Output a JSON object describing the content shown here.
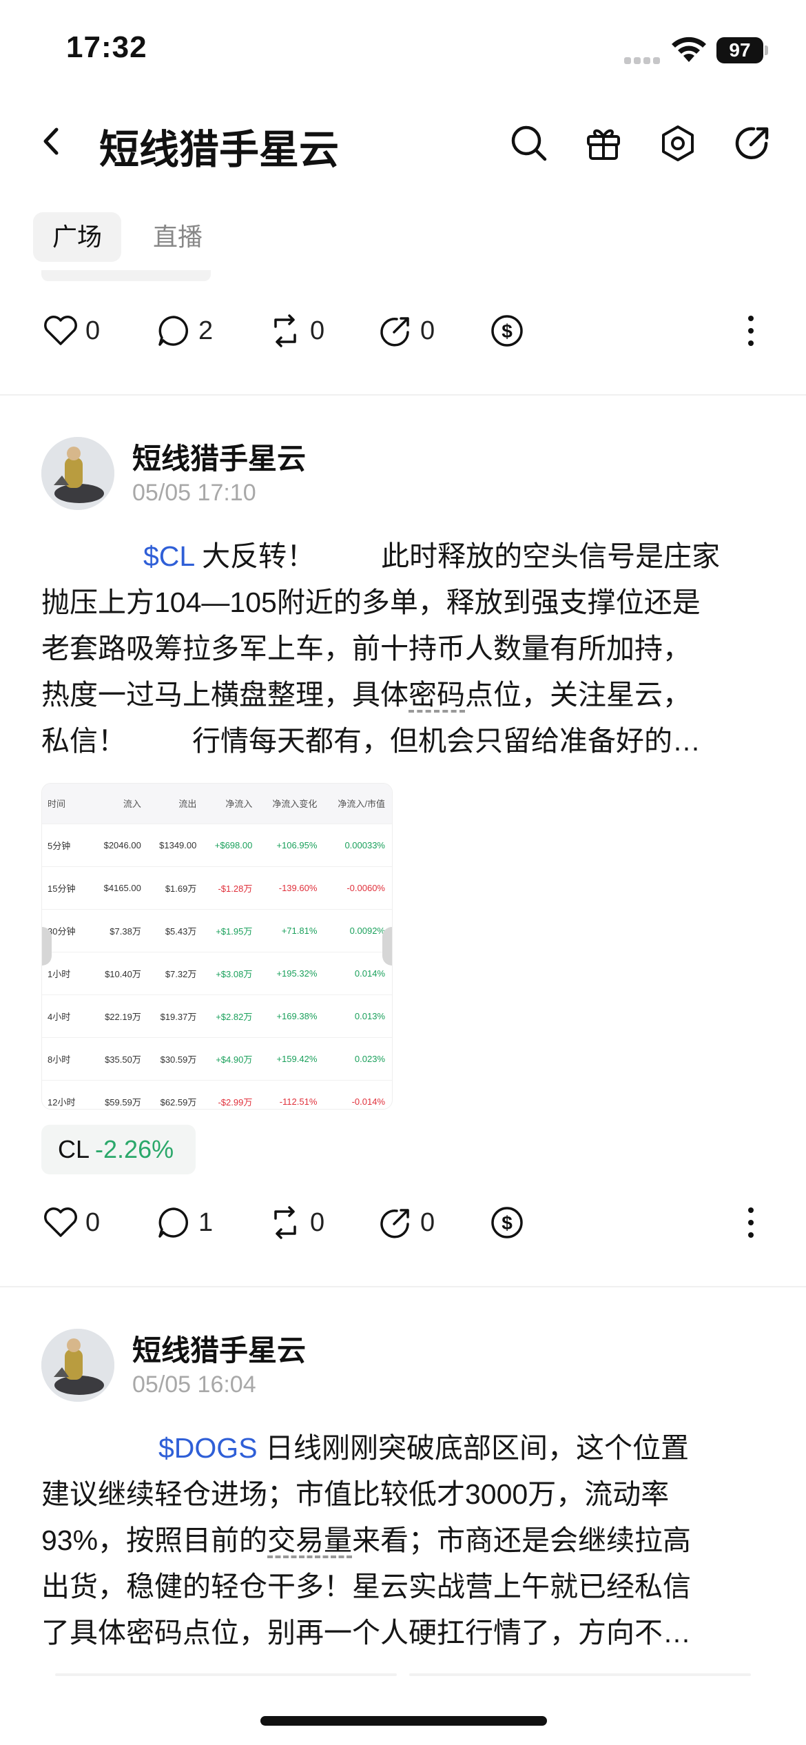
{
  "status_bar": {
    "time": "17:32",
    "battery": "97"
  },
  "nav": {
    "title": "短线猎手星云",
    "icons": [
      "back-icon",
      "search-icon",
      "gift-icon",
      "settings-icon",
      "share-icon"
    ]
  },
  "tabs": [
    {
      "label": "广场",
      "active": true
    },
    {
      "label": "直播",
      "active": false
    }
  ],
  "top_actions": {
    "likes": "0",
    "comments": "2",
    "reposts": "0",
    "shares": "0"
  },
  "posts": [
    {
      "author": "短线猎手星云",
      "time": "05/05 17:10",
      "ticker": "$CL",
      "lines": {
        "l1a": "大反转！",
        "l1b": "此时释放的空头信号是庄家",
        "l2": "抛压上方104—105附近的多单，释放到强支撑位还是",
        "l3": "老套路吸筹拉多军上车，前十持币人数量有所加持，",
        "l4a": "热度一过马上横盘整理，具体",
        "l4u": "密码",
        "l4b": "点位，关注星云，",
        "l5a": "私信！",
        "l5b": "行情每天都有，但机会只留给准备好的…"
      },
      "table": {
        "headers": [
          "时间",
          "流入",
          "流出",
          "净流入",
          "净流入变化",
          "净流入/市值"
        ],
        "rows": [
          [
            "5分钟",
            "$2046.00",
            "$1349.00",
            "+$698.00",
            "+106.95%",
            "0.00033%"
          ],
          [
            "15分钟",
            "$4165.00",
            "$1.69万",
            "-$1.28万",
            "-139.60%",
            "-0.0060%"
          ],
          [
            "30分钟",
            "$7.38万",
            "$5.43万",
            "+$1.95万",
            "+71.81%",
            "0.0092%"
          ],
          [
            "1小时",
            "$10.40万",
            "$7.32万",
            "+$3.08万",
            "+195.32%",
            "0.014%"
          ],
          [
            "4小时",
            "$22.19万",
            "$19.37万",
            "+$2.82万",
            "+169.38%",
            "0.013%"
          ],
          [
            "8小时",
            "$35.50万",
            "$30.59万",
            "+$4.90万",
            "+159.42%",
            "0.023%"
          ],
          [
            "12小时",
            "$59.59万",
            "$62.59万",
            "-$2.99万",
            "-112.51%",
            "-0.014%"
          ]
        ]
      },
      "chip": {
        "symbol": "CL",
        "change": "-2.26%"
      },
      "actions": {
        "likes": "0",
        "comments": "1",
        "reposts": "0",
        "shares": "0"
      }
    },
    {
      "author": "短线猎手星云",
      "time": "05/05 16:04",
      "ticker": "$DOGS",
      "lines": {
        "l1": "日线刚刚突破底部区间，这个位置",
        "l2": "建议继续轻仓进场；市值比较低才3000万，流动率",
        "l3a": "93%，按照目前的",
        "l3u": "交易量",
        "l3b": "来看；市商还是会继续拉高",
        "l4": "出货，稳健的轻仓干多！星云实战营上午就已经私信",
        "l5": "了具体密码点位，别再一个人硬扛行情了，方向不…"
      }
    }
  ],
  "colors": {
    "ticker_link": "#2f5fd7",
    "positive": "#1aa05b",
    "negative": "#e0303b",
    "chip_change": "#2aa86a"
  }
}
